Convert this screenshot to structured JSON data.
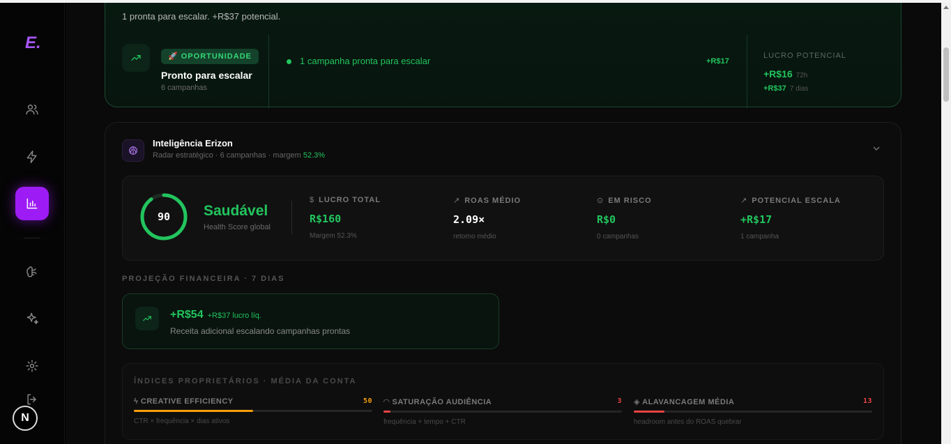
{
  "sidebar": {
    "logo": "E.",
    "avatar_letter": "N"
  },
  "opportunity": {
    "summary": "1 pronta para escalar. +R$37 potencial.",
    "badge": "🚀 OPORTUNIDADE",
    "title": "Pronto para escalar",
    "subtitle": "6 campanhas",
    "campaign_text": "1 campanha pronta para escalar",
    "campaign_value": "+R$17",
    "potential_label": "LUCRO POTENCIAL",
    "potential_1": "+R$16",
    "potential_1_period": "72h",
    "potential_2": "+R$37",
    "potential_2_period": "7 dias"
  },
  "intel": {
    "title": "Inteligência Erizon",
    "subtitle": "Radar estratégico · 6 campanhas · margem",
    "margin": "52.3%",
    "score": "90",
    "score_fraction": 0.9,
    "status": "Saudável",
    "status_sub": "Health Score global",
    "metrics": [
      {
        "icon": "$",
        "label": "LUCRO TOTAL",
        "value": "R$160",
        "sub": "Margem 52.3%",
        "color": "#22c55e"
      },
      {
        "icon": "↗",
        "label": "ROAS MÉDIO",
        "value": "2.09×",
        "sub": "retorno médio",
        "color": "#ffffff"
      },
      {
        "icon": "⊙",
        "label": "EM RISCO",
        "value": "R$0",
        "sub": "0 campanhas",
        "color": "#22c55e"
      },
      {
        "icon": "↗",
        "label": "POTENCIAL ESCALA",
        "value": "+R$17",
        "sub": "1 campanha",
        "color": "#22c55e"
      }
    ]
  },
  "projection": {
    "label": "PROJEÇÃO FINANCEIRA · 7 DIAS",
    "value": "+R$54",
    "net": "+R$37 lucro líq.",
    "sub": "Receita adicional escalando campanhas prontas"
  },
  "indices": {
    "label": "ÍNDICES PROPRIETÁRIOS · MÉDIA DA CONTA",
    "items": [
      {
        "icon": "ϟ",
        "label": "CREATIVE EFFICIENCY",
        "value": "50",
        "fraction": 0.5,
        "color": "#f59e0b",
        "sub": "CTR × frequência × dias ativos"
      },
      {
        "icon": "◠",
        "label": "SATURAÇÃO AUDIÊNCIA",
        "value": "3",
        "fraction": 0.03,
        "color": "#ef4444",
        "sub": "frequência + tempo + CTR"
      },
      {
        "icon": "◈",
        "label": "ALAVANCAGEM MÉDIA",
        "value": "13",
        "fraction": 0.13,
        "color": "#ef4444",
        "sub": "headroom antes do ROAS quebrar"
      }
    ]
  }
}
